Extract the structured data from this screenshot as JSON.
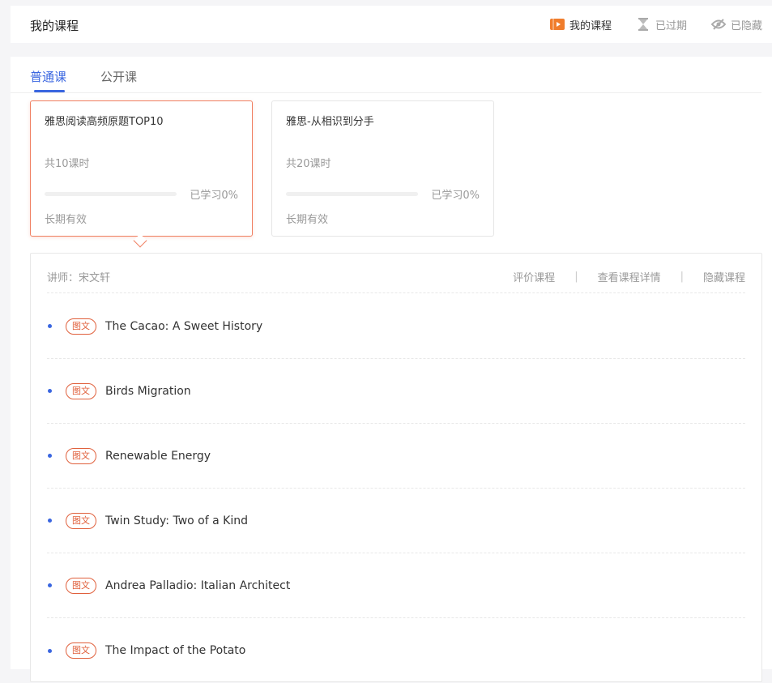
{
  "header": {
    "title": "我的课程",
    "nav": [
      {
        "label": "我的课程",
        "icon": "play-icon",
        "active": true
      },
      {
        "label": "已过期",
        "icon": "hourglass-icon",
        "active": false
      },
      {
        "label": "已隐藏",
        "icon": "eye-off-icon",
        "active": false
      }
    ]
  },
  "tabs": [
    {
      "label": "普通课",
      "active": true
    },
    {
      "label": "公开课",
      "active": false
    }
  ],
  "courses": [
    {
      "title": "雅思阅读高频原题TOP10",
      "lessons": "共10课时",
      "progress_text": "已学习0%",
      "progress": 0,
      "validity": "长期有效",
      "selected": true
    },
    {
      "title": "雅思-从相识到分手",
      "lessons": "共20课时",
      "progress_text": "已学习0%",
      "progress": 0,
      "validity": "长期有效",
      "selected": false
    }
  ],
  "detail": {
    "teacher": "讲师：宋文轩",
    "actions": [
      "评价课程",
      "查看课程详情",
      "隐藏课程"
    ],
    "separator": "|",
    "lessons": [
      {
        "badge": "图文",
        "title": "The Cacao: A Sweet History"
      },
      {
        "badge": "图文",
        "title": "Birds Migration"
      },
      {
        "badge": "图文",
        "title": "Renewable Energy"
      },
      {
        "badge": "图文",
        "title": "Twin Study: Two of a Kind"
      },
      {
        "badge": "图文",
        "title": "Andrea Palladio: Italian Architect"
      },
      {
        "badge": "图文",
        "title": "The Impact of the Potato"
      }
    ]
  },
  "colors": {
    "accent": "#3a66e0",
    "brand_orange": "#f08062",
    "badge": "#e0603c"
  }
}
